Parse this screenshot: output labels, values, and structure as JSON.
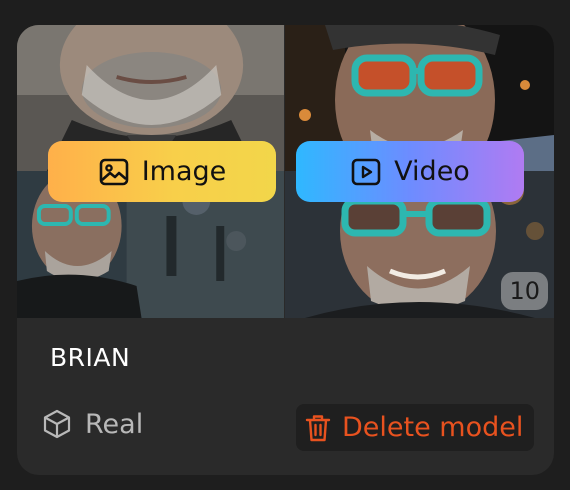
{
  "card": {
    "model_name": "BRIAN",
    "photo_count": "10",
    "model_type": "Real"
  },
  "buttons": {
    "image_label": "Image",
    "video_label": "Video",
    "delete_label": "Delete model"
  },
  "colors": {
    "card_bg": "#2a2a2a",
    "page_bg": "#1e1e1e",
    "delete_text": "#e8521f",
    "image_gradient_start": "#ffb04a",
    "image_gradient_end": "#f2d64a",
    "video_gradient_start": "#2fb8ff",
    "video_gradient_end": "#b07bf2"
  },
  "icons": {
    "image_button_icon": "image-icon",
    "video_button_icon": "play-icon",
    "type_icon": "cube-icon",
    "delete_icon": "trash-icon"
  }
}
